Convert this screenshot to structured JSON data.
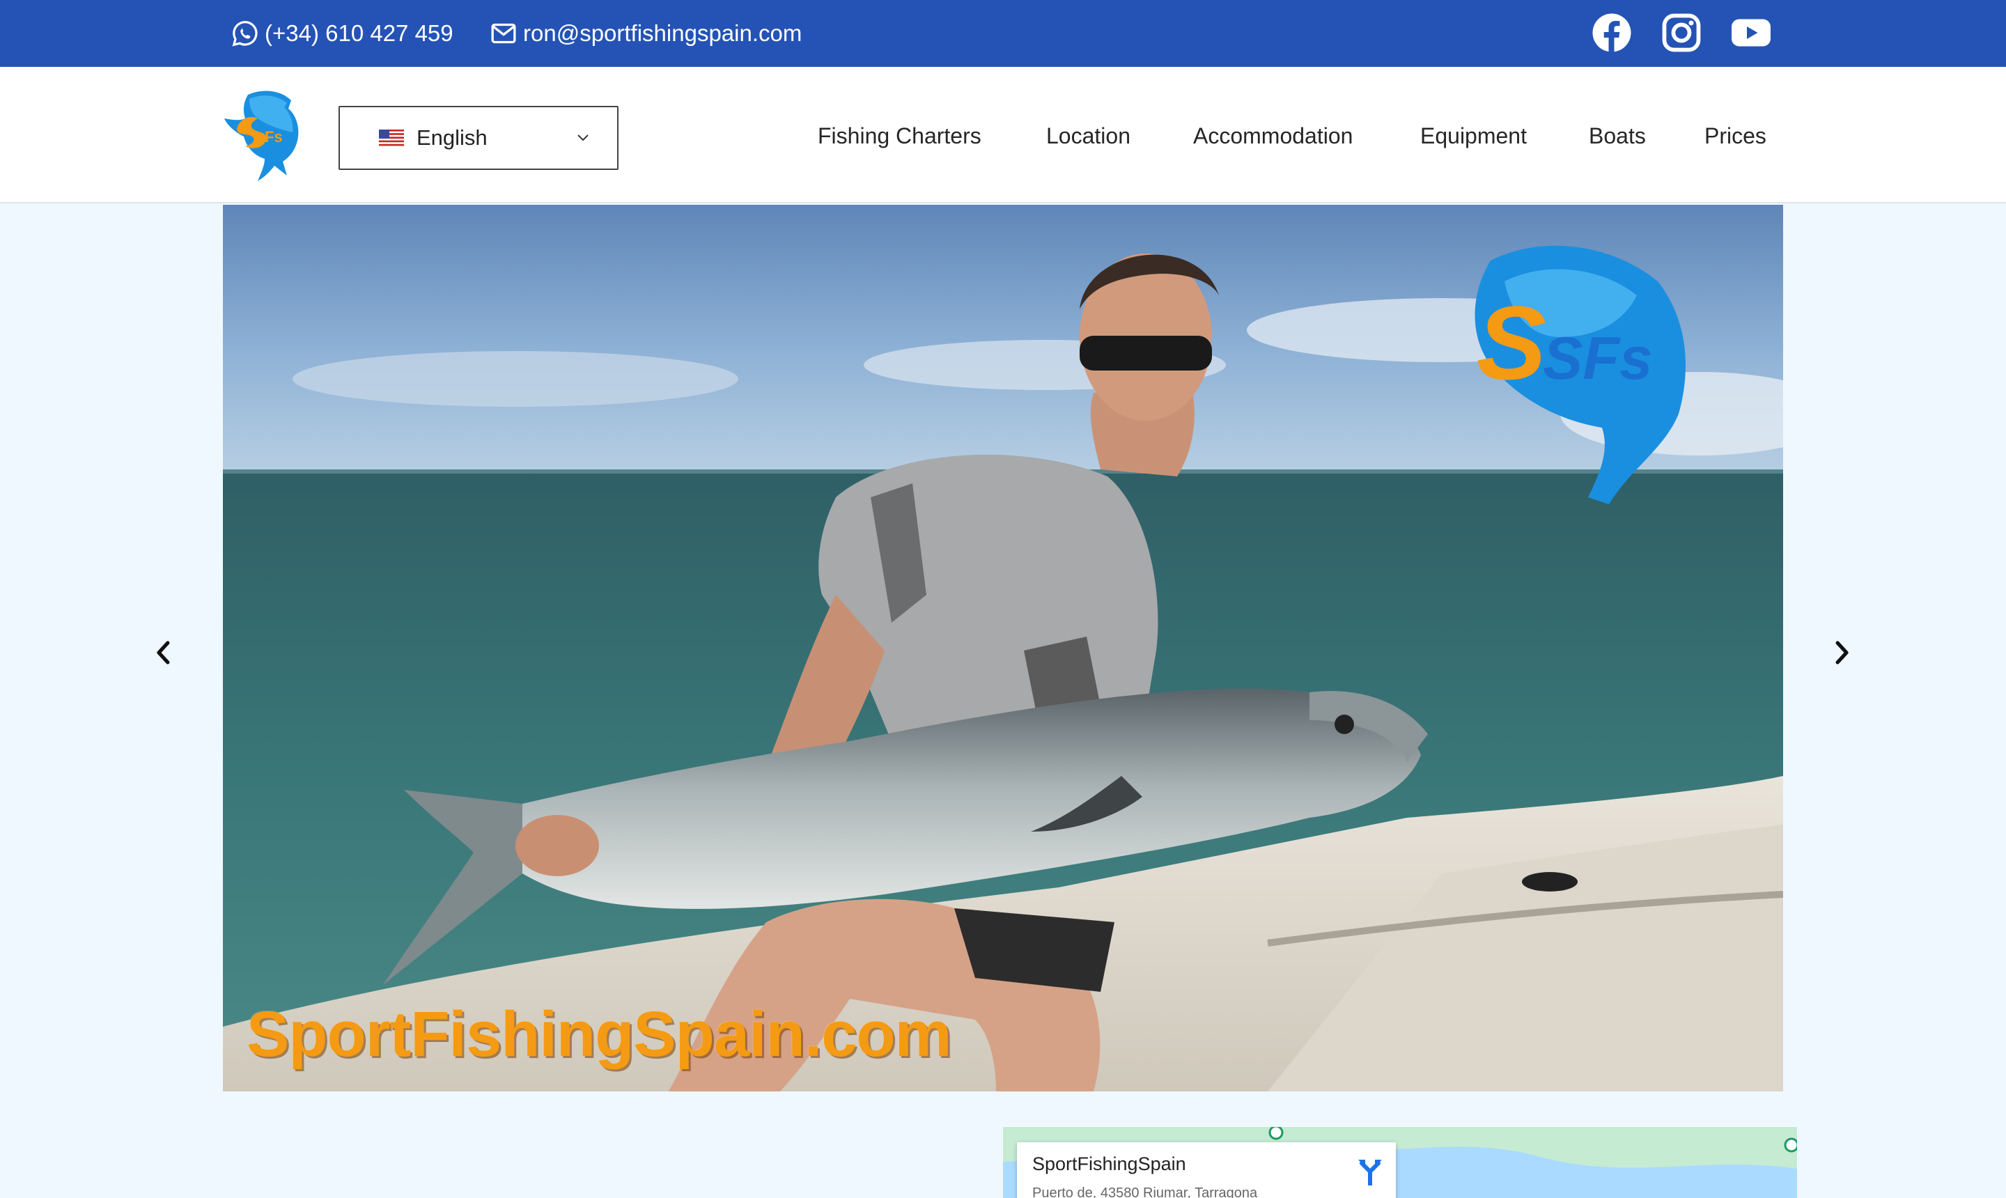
{
  "topbar": {
    "phone": "(+34) 610 427 459",
    "email": "ron@sportfishingspain.com",
    "social": [
      {
        "icon": "facebook-icon"
      },
      {
        "icon": "instagram-icon"
      },
      {
        "icon": "youtube-icon"
      }
    ],
    "bg_color": "#2453b5"
  },
  "header": {
    "logo_icon": "sfs-marlin-logo",
    "language": {
      "flag": "us-flag-icon",
      "selected": "English"
    },
    "nav": [
      {
        "label": "Fishing Charters"
      },
      {
        "label": "Location"
      },
      {
        "label": "Accommodation"
      },
      {
        "label": "Equipment"
      },
      {
        "label": "Boats"
      },
      {
        "label": "Prices"
      }
    ]
  },
  "slider": {
    "caption": "SportFishingSpain.com",
    "logo_text": "SFs",
    "prev_icon": "chevron-left-icon",
    "next_icon": "chevron-right-icon"
  },
  "map": {
    "place_name": "SportFishingSpain",
    "address": "Puerto de, 43580 Riumar, Tarragona",
    "directions_icon": "directions-icon"
  },
  "colors": {
    "accent": "#2453b5",
    "page_bg": "#f0f8ff",
    "caption_orange": "#f59a13",
    "logo_blue": "#1a8fe0"
  }
}
